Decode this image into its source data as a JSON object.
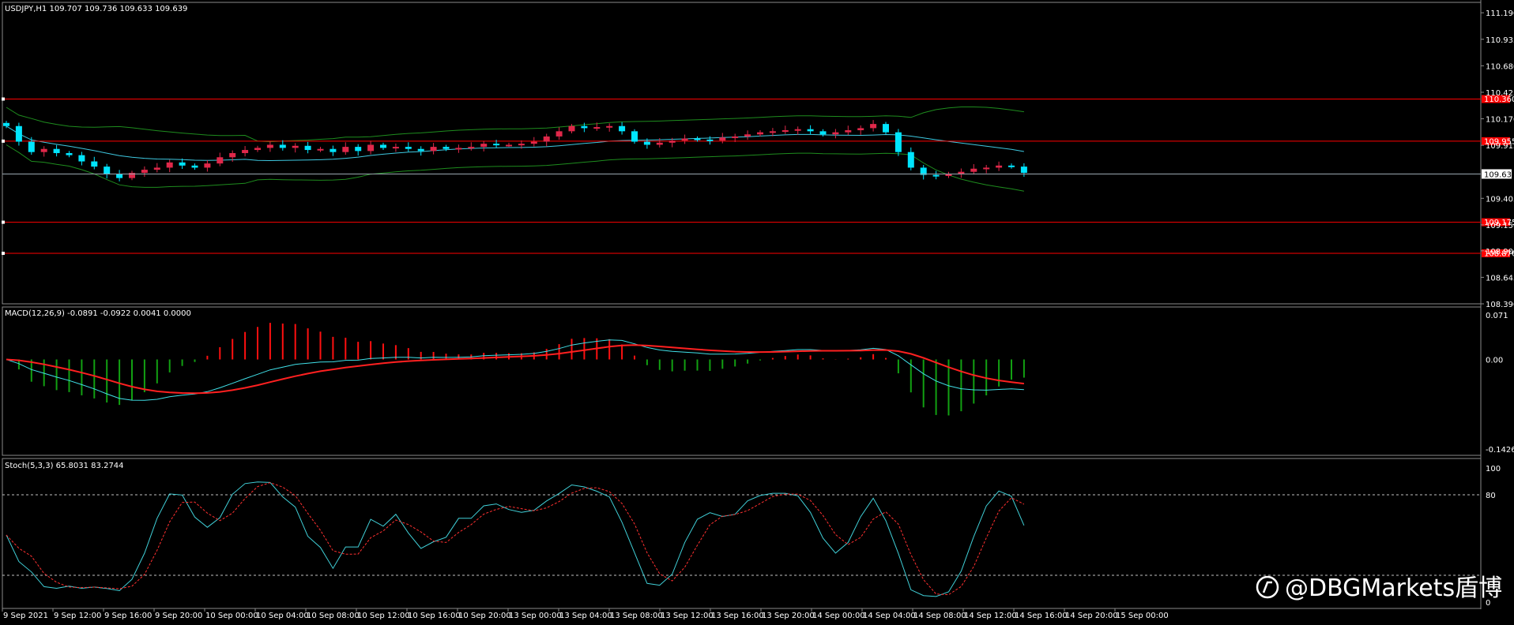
{
  "window": {
    "symbol_header": "USDJPY,H1  109.707 109.736 109.633 109.639"
  },
  "panels": {
    "price": {
      "ticks": [
        "111.190",
        "110.935",
        "110.680",
        "110.425",
        "110.170",
        "109.915",
        "109.405",
        "109.150",
        "108.900",
        "108.645",
        "108.390"
      ],
      "current_price": "109.639",
      "levels": [
        {
          "label": "110.360",
          "value": 110.36
        },
        {
          "label": "109.955",
          "value": 109.955
        },
        {
          "label": "109.175",
          "value": 109.175
        },
        {
          "label": "108.876",
          "value": 108.876
        }
      ]
    },
    "macd": {
      "header": "MACD(12,26,9) -0.0891 -0.0922 0.0041 0.0000",
      "ticks": [
        "0.071",
        "0.00",
        "-0.1426"
      ]
    },
    "stoch": {
      "header": "Stoch(5,3,3) 65.8031 83.2744",
      "ticks": [
        "100",
        "80",
        "0"
      ]
    }
  },
  "x_axis": {
    "labels": [
      "9 Sep 2021",
      "9 Sep 12:00",
      "9 Sep 16:00",
      "9 Sep 20:00",
      "10 Sep 00:00",
      "10 Sep 04:00",
      "10 Sep 08:00",
      "10 Sep 12:00",
      "10 Sep 16:00",
      "10 Sep 20:00",
      "13 Sep 00:00",
      "13 Sep 04:00",
      "13 Sep 08:00",
      "13 Sep 12:00",
      "13 Sep 16:00",
      "13 Sep 20:00",
      "14 Sep 00:00",
      "14 Sep 04:00",
      "14 Sep 08:00",
      "14 Sep 12:00",
      "14 Sep 16:00",
      "14 Sep 20:00",
      "15 Sep 00:00"
    ]
  },
  "watermark": {
    "text": "@DBGMarkets盾博"
  },
  "colors": {
    "background": "#000000",
    "bull": "#e0284a",
    "bear": "#00e5ff",
    "level": "#ff0000",
    "bands": "#1e8c1e",
    "ma": "#3ec8e0",
    "macd_signal": "#ff2020",
    "macd_line": "#40e0e8",
    "hist_pos": "#ff1010",
    "hist_neg": "#12a012",
    "stoch_main": "#40d0d8",
    "stoch_signal": "#ff3030"
  },
  "chart_data": {
    "type": "candlestick",
    "instrument": "USDJPY",
    "timeframe": "H1",
    "price_ylim": [
      108.39,
      111.29
    ],
    "candles_close": [
      110.1,
      109.95,
      109.85,
      109.88,
      109.84,
      109.82,
      109.76,
      109.71,
      109.64,
      109.6,
      109.65,
      109.68,
      109.7,
      109.75,
      109.72,
      109.7,
      109.74,
      109.8,
      109.84,
      109.87,
      109.89,
      109.92,
      109.89,
      109.91,
      109.87,
      109.88,
      109.85,
      109.9,
      109.86,
      109.92,
      109.89,
      109.9,
      109.88,
      109.86,
      109.9,
      109.88,
      109.89,
      109.9,
      109.93,
      109.92,
      109.92,
      109.93,
      109.95,
      110.0,
      110.05,
      110.1,
      110.08,
      110.09,
      110.1,
      110.05,
      109.95,
      109.92,
      109.94,
      109.96,
      109.98,
      109.97,
      109.96,
      109.99,
      110.0,
      110.02,
      110.04,
      110.05,
      110.06,
      110.07,
      110.05,
      110.02,
      110.04,
      110.06,
      110.08,
      110.12,
      110.04,
      109.85,
      109.7,
      109.63,
      109.62,
      109.64,
      109.66,
      109.69,
      109.7,
      109.72,
      109.71,
      109.65
    ],
    "macd": {
      "ylim": [
        -0.1426,
        0.071
      ],
      "latest": {
        "main": -0.0891,
        "signal": -0.0922,
        "hist": 0.0041
      }
    },
    "stoch": {
      "ylim": [
        0,
        100
      ],
      "levels": [
        20,
        80
      ],
      "latest": {
        "k": 65.8031,
        "d": 83.2744
      }
    }
  }
}
